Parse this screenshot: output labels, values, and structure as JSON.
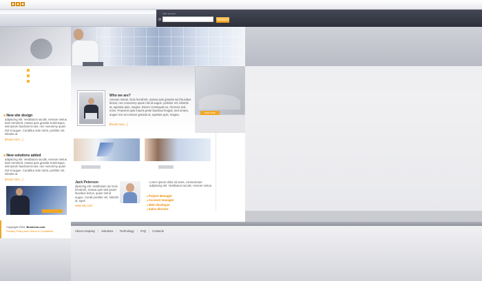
{
  "search": {
    "label": "site search",
    "placeholder": "",
    "button": "SEARCH"
  },
  "hero_button": "read more",
  "news": [
    {
      "title": "New site design",
      "text": "adipiscing elit. Vestibulum iaculis. Aenean metus. Duis hendrerit, massa quis gravida scelerisque, wisi ipsum faucibus lectus, nec nonummy quam nisl id augue. Curabitur ante tortor, porttitor vel, lobortis at.",
      "more": "[Read more...]"
    },
    {
      "title": "New solutions added",
      "text": "adipiscing elit. Vestibulum iaculis. Aenean metus. Duis hendrerit, massa quis gravida scelerisque, wisi ipsum faucibus lectus, nec nonummy quam nisl id augue. Curabitur ante tortor, porttitor vel, lobortis at.",
      "more": "[Read more...]"
    }
  ],
  "who": {
    "title": "Who we are?",
    "text": "Aenean metus. Duis hendrerit, massa quis gravida sed faucibus lectus, nec nonummy quam nisl id augue. porttitor vel, lobortis at, egestas quis, magna. Donec consequat eu, rhoncus sed, enim. Praesent quis mauris pede faucibus feugiat, sed ornare, augue non accumsan gravida at, egestas quis, magna.",
    "more": "[Read more...]"
  },
  "jack": {
    "title": "Jack Peterson",
    "text": "dipiscing elit. Vestibulum iac Duis hendrerit, massa quis wisi ipsum faucibus lectus, quam nisl id augue. Curab porttitor vel, lobortis at, eges",
    "link": "www.site.com"
  },
  "lorem2": "Lorem ipsum dolor sit amet, consectetuer adipiscing elit. Vestibulum iaculis. Aenean metus.",
  "roles": [
    "Project Manager",
    "Account manager",
    "Web developer",
    "Sales director"
  ],
  "footer": {
    "copyright": "Copyright 2004,",
    "brand": "Business.com",
    "privacy": "Privacy Policy and Terms & Conditions",
    "links": [
      "About company",
      "Solutions",
      "Technology",
      "FAQ",
      "Contacts"
    ]
  }
}
